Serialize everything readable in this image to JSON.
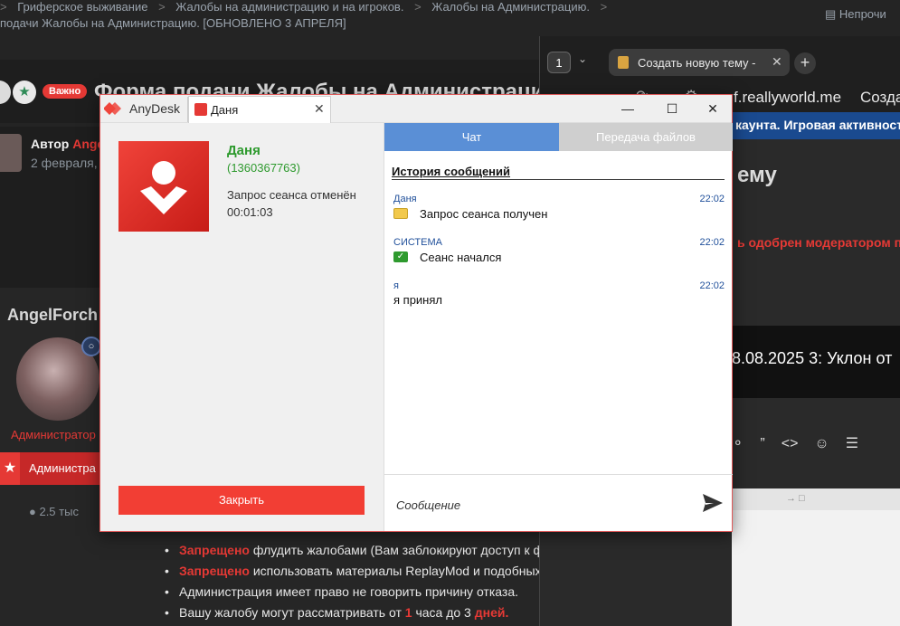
{
  "forum": {
    "breadcrumbs": [
      "Гриферское выживание",
      "Жалобы на администрацию и на игроков.",
      "Жалобы на Администрацию."
    ],
    "breadcrumb_sep": ">",
    "breadcrumb_line2": "подачи Жалобы на Администрацию. [ОБНОВЛЕНО 3 АПРЕЛЯ]",
    "unread_label": "Непрочи",
    "badge_important": "Важно",
    "thread_title": "Форма подачи Жалобы на Администраци",
    "author_label": "Автор",
    "author_name": "Ange",
    "author_date": "2 февраля,",
    "username": "AngelForch",
    "role_text": "Администратор",
    "role_bar_text": "Администра",
    "messages_count": "2.5 тыс",
    "rules": [
      {
        "red": "Запрещено",
        "text": " флудить жалобами (Вам заблокируют доступ к форуму)."
      },
      {
        "red": "Запрещено",
        "text": " использовать материалы ReplayMod и подобных для доказательств. Моментальный отказ, либо блокир"
      },
      {
        "red": "",
        "text": "Администрация имеет право не говорить причину отказа."
      },
      {
        "red": "",
        "text": "Вашу жалобу могут рассматривать от ",
        "num": "1",
        "text2": " часа до 3 ",
        "red2": "дней."
      }
    ]
  },
  "browser": {
    "tab_count": "1",
    "tab_title": "Создать новую тему - F",
    "url": "f.reallyworld.me",
    "url_suffix": "Созда",
    "site_banner": "каунта. Игровая активност",
    "site_heading": "ему",
    "site_red": "ь одобрен модератором п",
    "site_dark_title": "8.08.2025 3: Уклон от",
    "toolbar_icons": [
      "link-icon",
      "quote-icon",
      "code-icon",
      "smile-icon",
      "list-icon"
    ]
  },
  "anydesk": {
    "app_name": "AnyDesk",
    "tab_name": "Даня",
    "contact_name": "Даня",
    "contact_id": "(1360367763)",
    "status": "Запрос сеанса отменён",
    "duration": "00:01:03",
    "close_button": "Закрыть",
    "tab_chat": "Чат",
    "tab_files": "Передача файлов",
    "history_title": "История сообщений",
    "messages": [
      {
        "from": "Даня",
        "time": "22:02",
        "text": "Запрос сеанса получен",
        "icon": "session-request-icon"
      },
      {
        "from": "СИСТЕМА",
        "time": "22:02",
        "text": "Сеанс начался",
        "icon": "session-start-icon"
      },
      {
        "from": "я",
        "time": "22:02",
        "text": "я принял",
        "icon": ""
      }
    ],
    "input_placeholder": "Сообщение",
    "accent": "#f23e34",
    "chat_tab_color": "#5a8fd6",
    "contact_color": "#2e9a2e"
  }
}
